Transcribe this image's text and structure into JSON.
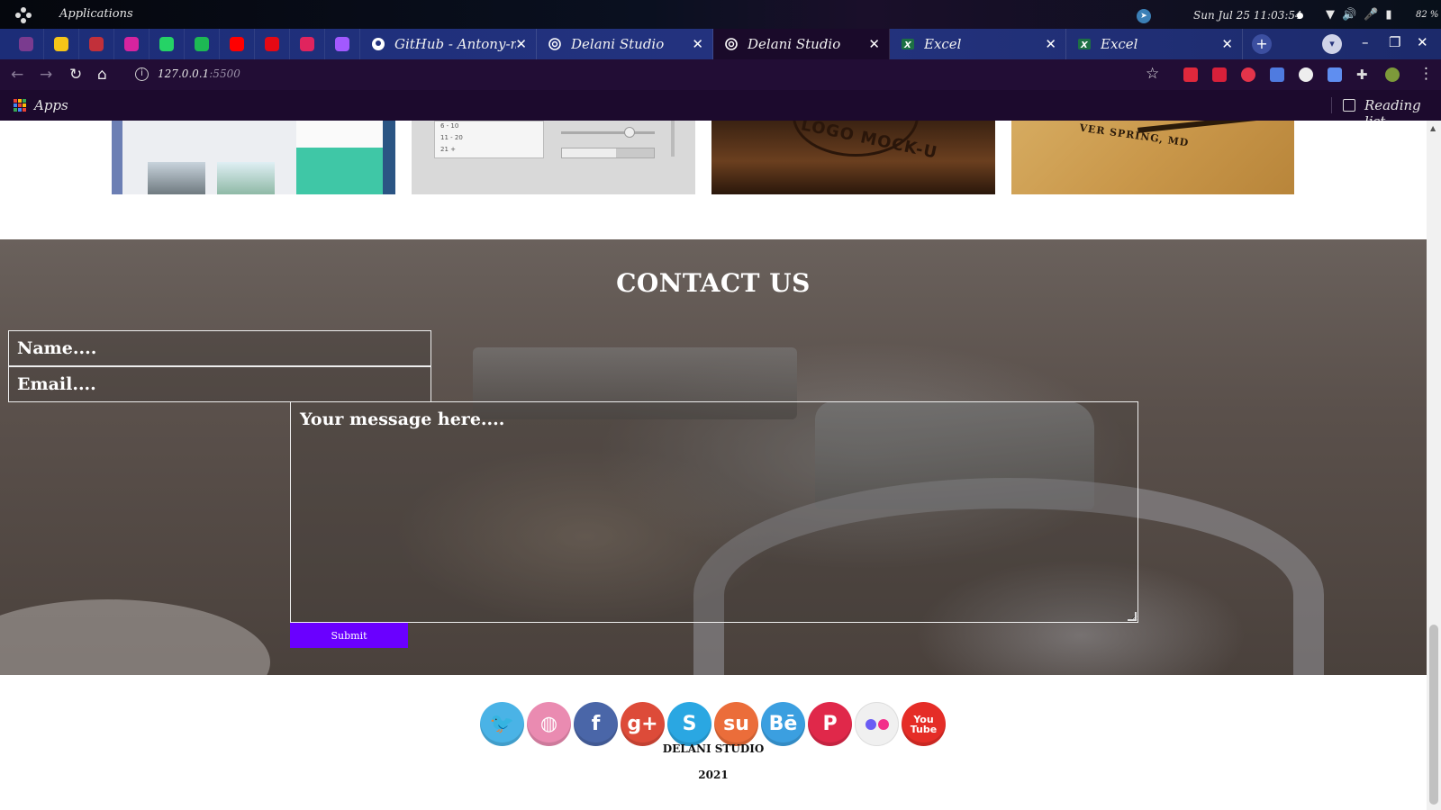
{
  "os": {
    "menu_label": "Applications",
    "clock": "Sun Jul 25  11:03:54",
    "battery": "82 %"
  },
  "tabs": {
    "pinned": [
      {
        "icon": "grape-app-icon",
        "color": "#7a3b8f"
      },
      {
        "icon": "imdb-icon",
        "color": "#f5c518"
      },
      {
        "icon": "app-icon",
        "color": "#c2303a"
      },
      {
        "icon": "instagram-icon",
        "color": "#d6249f"
      },
      {
        "icon": "whatsapp-icon",
        "color": "#25d366"
      },
      {
        "icon": "spotify-icon",
        "color": "#1db954"
      },
      {
        "icon": "youtube-icon",
        "color": "#ff0000"
      },
      {
        "icon": "netflix-icon",
        "color": "#e50914"
      },
      {
        "icon": "video-app-icon",
        "color": "#e0245e"
      },
      {
        "icon": "figma-icon",
        "color": "#a259ff"
      }
    ],
    "open": [
      {
        "title": "GitHub - Antony-me",
        "icon": "github-icon",
        "active": false
      },
      {
        "title": "Delani Studio",
        "icon": "website-icon",
        "active": false
      },
      {
        "title": "Delani Studio",
        "icon": "website-icon",
        "active": true
      },
      {
        "title": "Excel",
        "icon": "excel-icon",
        "active": false
      },
      {
        "title": "Excel",
        "icon": "excel-icon",
        "active": false
      }
    ]
  },
  "toolbar": {
    "url_host": "127.0.0.1",
    "url_port": ":5500"
  },
  "bookmarks": {
    "apps_label": "Apps",
    "reading_list_label": "Reading list"
  },
  "portfolio": {
    "list_rows": [
      "6 - 10",
      "11 - 20",
      "21 +"
    ],
    "mock_logo_text": "LOGO MOCK-U",
    "location_text": "VER SPRING, MD"
  },
  "contact": {
    "title": "CONTACT US",
    "name_placeholder": "Name....",
    "email_placeholder": "Email....",
    "message_placeholder": "Your message here....",
    "submit_label": "Submit"
  },
  "social": [
    {
      "name": "twitter-icon",
      "glyph": "🐦",
      "color": "#4ab3e6"
    },
    {
      "name": "dribbble-icon",
      "glyph": "◍",
      "color": "#ea8bb1"
    },
    {
      "name": "facebook-icon",
      "glyph": "f",
      "color": "#4a66a8"
    },
    {
      "name": "google-plus-icon",
      "glyph": "g+",
      "color": "#dd4b39"
    },
    {
      "name": "skype-icon",
      "glyph": "S",
      "color": "#2aa7e2"
    },
    {
      "name": "stumbleupon-icon",
      "glyph": "su",
      "color": "#eb6d3a"
    },
    {
      "name": "behance-icon",
      "glyph": "Bē",
      "color": "#3b9fe0"
    },
    {
      "name": "pinterest-icon",
      "glyph": "P",
      "color": "#e0284a"
    },
    {
      "name": "flickr-icon",
      "glyph": "●●",
      "color": "#f0f0f0"
    },
    {
      "name": "youtube-icon",
      "glyph": "You Tube",
      "color": "#e52d27"
    }
  ],
  "footer": {
    "name": "DELANI STUDIO",
    "year": "2021"
  }
}
